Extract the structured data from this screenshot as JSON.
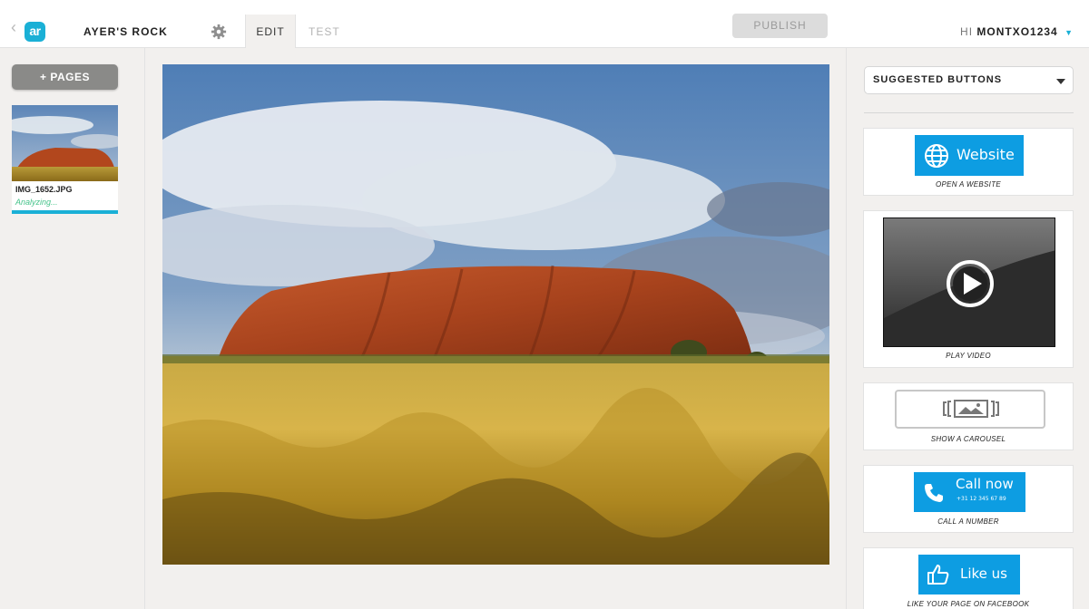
{
  "header": {
    "logo_text": "ar",
    "project_title": "AYER'S ROCK",
    "tabs": [
      {
        "label": "EDIT",
        "active": true
      },
      {
        "label": "TEST",
        "active": false
      }
    ],
    "publish_label": "PUBLISH",
    "greeting_prefix": "HI",
    "username": "MONTXO1234"
  },
  "sidebar": {
    "add_pages_label": "+ PAGES",
    "pages": [
      {
        "filename": "IMG_1652.JPG",
        "status": "Analyzing...",
        "progress": 1.0
      }
    ]
  },
  "suggestions": {
    "dropdown_label": "SUGGESTED BUTTONS",
    "cards": [
      {
        "button_label": "Website",
        "icon": "globe-icon",
        "caption": "OPEN A WEBSITE"
      },
      {
        "icon": "play-icon",
        "caption": "PLAY VIDEO"
      },
      {
        "icon": "carousel-icon",
        "caption": "SHOW A CAROUSEL"
      },
      {
        "button_label": "Call now",
        "sub_label": "+31 12 345 67 89",
        "icon": "phone-icon",
        "caption": "CALL A NUMBER"
      },
      {
        "button_label": "Like us",
        "icon": "thumbs-up-icon",
        "caption": "LIKE YOUR PAGE ON FACEBOOK"
      }
    ]
  },
  "colors": {
    "accent": "#1ab0d6",
    "button_blue": "#0d9de2",
    "status_green": "#45c38a",
    "publish_disabled": "#dcdcdc"
  }
}
